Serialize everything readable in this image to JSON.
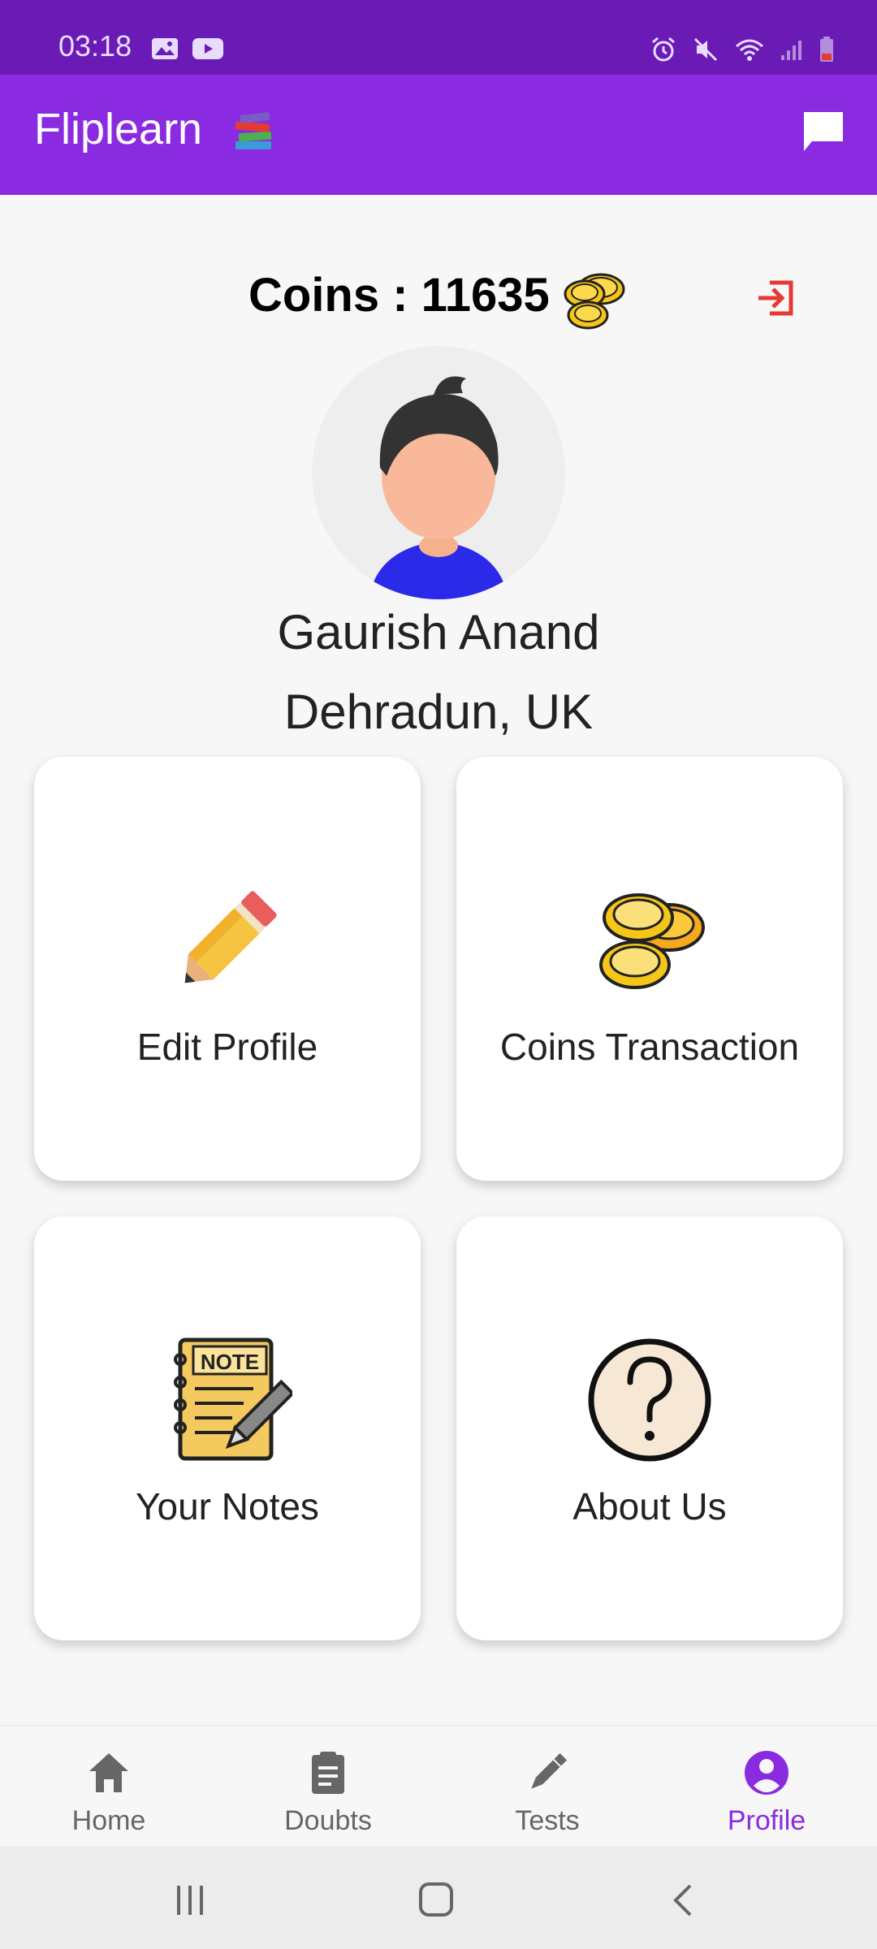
{
  "status_bar": {
    "time": "03:18"
  },
  "app_bar": {
    "title": "Fliplearn"
  },
  "coins": {
    "label": "Coins : 11635"
  },
  "profile": {
    "name": "Gaurish Anand",
    "location": "Dehradun, UK"
  },
  "cards": [
    {
      "label": "Edit Profile",
      "icon": "pencil-icon"
    },
    {
      "label": "Coins Transaction",
      "icon": "coins-icon"
    },
    {
      "label": "Your Notes",
      "icon": "notes-icon"
    },
    {
      "label": "About Us",
      "icon": "question-icon"
    }
  ],
  "bottom_nav": [
    {
      "label": "Home",
      "icon": "home-icon",
      "active": false
    },
    {
      "label": "Doubts",
      "icon": "clipboard-icon",
      "active": false
    },
    {
      "label": "Tests",
      "icon": "pen-icon",
      "active": false
    },
    {
      "label": "Profile",
      "icon": "account-icon",
      "active": true
    }
  ],
  "colors": {
    "primary": "#8a2be2",
    "status": "#6a1bb5",
    "logout": "#e53935"
  }
}
